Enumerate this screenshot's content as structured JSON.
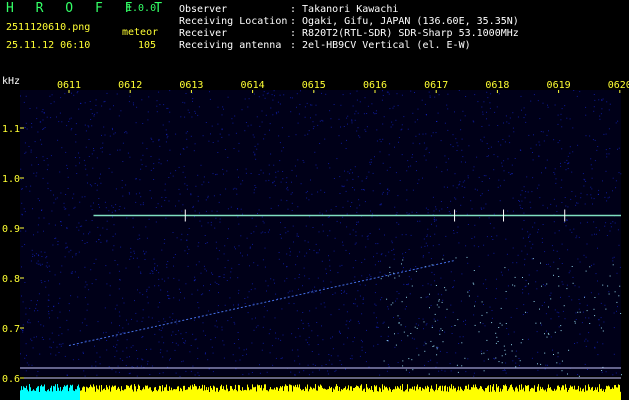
{
  "app": {
    "name": "H R O F F T",
    "version": "1.0.0"
  },
  "file": {
    "name": "2511120610.png",
    "datetime": "25.11.12 06:10"
  },
  "detection": {
    "label": "meteor",
    "count": "105"
  },
  "info": [
    {
      "label": "Observer",
      "value": ": Takanori Kawachi"
    },
    {
      "label": "Receiving Location",
      "value": ": Ogaki, Gifu, JAPAN (136.60E, 35.35N)"
    },
    {
      "label": "Receiver",
      "value": ": R820T2(RTL-SDR) SDR-Sharp 53.1000MHz"
    },
    {
      "label": "Receiving antenna",
      "value": ": 2el-HB9CV Vertical (el. E-W)"
    }
  ],
  "colors": {
    "background": "#000000",
    "text": "#ffffff",
    "ticks": "#ffff33",
    "title": "#33ff66",
    "noise": "#1a2fff",
    "hot": "#9fe8ff",
    "carrier": "#7fe0c0",
    "floor_yellow": "#ffff00",
    "floor_cyan": "#00ffff"
  },
  "chart_data": {
    "type": "heatmap",
    "ylabel": "kHz",
    "x_ticks": [
      "0611",
      "0612",
      "0613",
      "0614",
      "0615",
      "0616",
      "0617",
      "0618",
      "0619",
      "0620"
    ],
    "x_range_minutes": [
      611,
      620
    ],
    "y_ticks": [
      "1.1",
      "1.0",
      "0.9",
      "0.8",
      "0.7",
      "0.6"
    ],
    "y_tick_values": [
      1.1,
      1.0,
      0.9,
      0.8,
      0.7,
      0.6
    ],
    "ylim": [
      0.58,
      1.2
    ],
    "carrier_khz": 0.925,
    "carrier_start_minute": 611.4,
    "drift_line": {
      "start": [
        611.0,
        0.665
      ],
      "end": [
        617.3,
        0.835
      ]
    },
    "reference_lines_khz": [
      0.62,
      0.6
    ]
  }
}
